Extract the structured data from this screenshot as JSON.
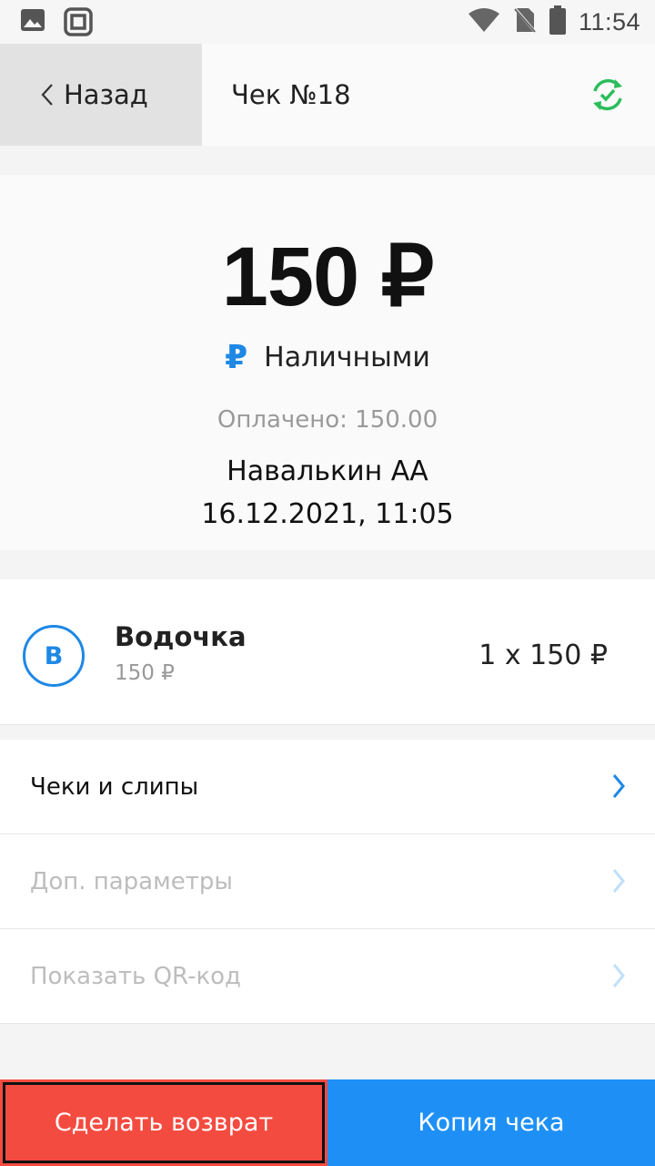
{
  "status_bar": {
    "time": "11:54",
    "left_icons": [
      "image-icon",
      "screen-record-icon"
    ],
    "right_icons": [
      "wifi-icon",
      "no-sim-icon",
      "battery-icon"
    ]
  },
  "header": {
    "back_label": "Назад",
    "title": "Чек №18",
    "sync_icon": "sync-check-icon"
  },
  "summary": {
    "amount": "150 ₽",
    "payment_method_symbol": "₽",
    "payment_method": "Наличными",
    "paid_label": "Оплачено:  150.00",
    "cashier": "Навалькин АА",
    "datetime": "16.12.2021, 11:05"
  },
  "item": {
    "avatar_letter": "В",
    "name": "Водочка",
    "price": "150 ₽",
    "quantity": "1 x 150 ₽"
  },
  "menu": [
    {
      "label": "Чеки и слипы",
      "enabled": true
    },
    {
      "label": "Доп. параметры",
      "enabled": false
    },
    {
      "label": "Показать QR-код",
      "enabled": false
    }
  ],
  "actions": {
    "refund_label": "Сделать возврат",
    "copy_label": "Копия чека"
  },
  "colors": {
    "accent_blue": "#1e90f5",
    "refund_red": "#f44b40",
    "sync_green": "#2bbd5a"
  }
}
